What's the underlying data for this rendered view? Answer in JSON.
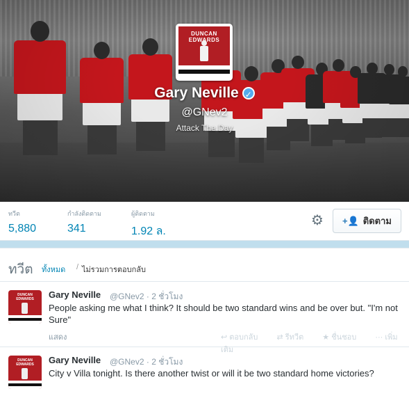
{
  "profile": {
    "avatar_text": "DUNCAN\nEDWARDS",
    "name": "Gary Neville",
    "verified_icon": "verified-badge-icon",
    "handle": "@GNev2",
    "bio": "Attack The Day"
  },
  "stats": [
    {
      "label": "ทวีต",
      "value": "5,880"
    },
    {
      "label": "กำลังติดตาม",
      "value": "341"
    },
    {
      "label": "ผู้ติดตาม",
      "value": "1.92 ล."
    }
  ],
  "actions": {
    "settings_icon": "gear-icon",
    "follow_icon": "add-user-icon",
    "follow_label": "ติดตาม"
  },
  "timeline": {
    "title": "ทวีต",
    "tab_all": "ทั้งหมด",
    "separator": "/",
    "tab_no_replies": "ไม่รวมการตอบกลับ"
  },
  "tweets": [
    {
      "name": "Gary Neville",
      "handle": "@GNev2 · 2 ชั่วโมง",
      "text": "People asking me what I think? It should be two standard wins and be over but. \"I'm not Sure\"",
      "expand": "แสดง",
      "reply": "ตอบกลับ",
      "retweet": "รีทวีต",
      "favorite": "ชื่นชอบ",
      "more": "เพิ่มเติม"
    },
    {
      "name": "Gary Neville",
      "handle": "@GNev2 · 2 ชั่วโมง",
      "text": "City v Villa tonight. Is there another twist or will it be two standard home victories?"
    }
  ],
  "colors": {
    "link": "#0084b4",
    "muted": "#8899a6",
    "shirt_red": "#c4161c",
    "background": "#c0deed"
  }
}
